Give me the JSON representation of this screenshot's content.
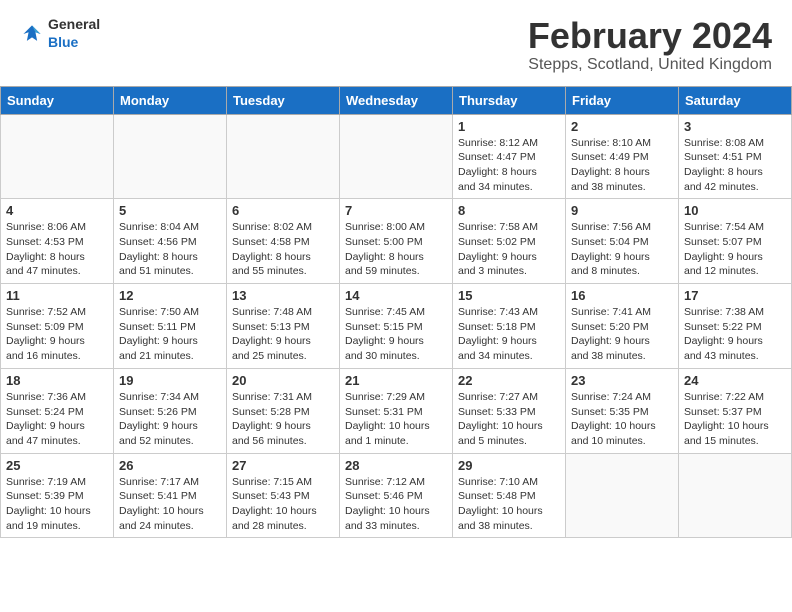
{
  "header": {
    "title": "February 2024",
    "location": "Stepps, Scotland, United Kingdom",
    "logo_general": "General",
    "logo_blue": "Blue"
  },
  "days_of_week": [
    "Sunday",
    "Monday",
    "Tuesday",
    "Wednesday",
    "Thursday",
    "Friday",
    "Saturday"
  ],
  "weeks": [
    [
      {
        "day": "",
        "info": ""
      },
      {
        "day": "",
        "info": ""
      },
      {
        "day": "",
        "info": ""
      },
      {
        "day": "",
        "info": ""
      },
      {
        "day": "1",
        "info": "Sunrise: 8:12 AM\nSunset: 4:47 PM\nDaylight: 8 hours\nand 34 minutes."
      },
      {
        "day": "2",
        "info": "Sunrise: 8:10 AM\nSunset: 4:49 PM\nDaylight: 8 hours\nand 38 minutes."
      },
      {
        "day": "3",
        "info": "Sunrise: 8:08 AM\nSunset: 4:51 PM\nDaylight: 8 hours\nand 42 minutes."
      }
    ],
    [
      {
        "day": "4",
        "info": "Sunrise: 8:06 AM\nSunset: 4:53 PM\nDaylight: 8 hours\nand 47 minutes."
      },
      {
        "day": "5",
        "info": "Sunrise: 8:04 AM\nSunset: 4:56 PM\nDaylight: 8 hours\nand 51 minutes."
      },
      {
        "day": "6",
        "info": "Sunrise: 8:02 AM\nSunset: 4:58 PM\nDaylight: 8 hours\nand 55 minutes."
      },
      {
        "day": "7",
        "info": "Sunrise: 8:00 AM\nSunset: 5:00 PM\nDaylight: 8 hours\nand 59 minutes."
      },
      {
        "day": "8",
        "info": "Sunrise: 7:58 AM\nSunset: 5:02 PM\nDaylight: 9 hours\nand 3 minutes."
      },
      {
        "day": "9",
        "info": "Sunrise: 7:56 AM\nSunset: 5:04 PM\nDaylight: 9 hours\nand 8 minutes."
      },
      {
        "day": "10",
        "info": "Sunrise: 7:54 AM\nSunset: 5:07 PM\nDaylight: 9 hours\nand 12 minutes."
      }
    ],
    [
      {
        "day": "11",
        "info": "Sunrise: 7:52 AM\nSunset: 5:09 PM\nDaylight: 9 hours\nand 16 minutes."
      },
      {
        "day": "12",
        "info": "Sunrise: 7:50 AM\nSunset: 5:11 PM\nDaylight: 9 hours\nand 21 minutes."
      },
      {
        "day": "13",
        "info": "Sunrise: 7:48 AM\nSunset: 5:13 PM\nDaylight: 9 hours\nand 25 minutes."
      },
      {
        "day": "14",
        "info": "Sunrise: 7:45 AM\nSunset: 5:15 PM\nDaylight: 9 hours\nand 30 minutes."
      },
      {
        "day": "15",
        "info": "Sunrise: 7:43 AM\nSunset: 5:18 PM\nDaylight: 9 hours\nand 34 minutes."
      },
      {
        "day": "16",
        "info": "Sunrise: 7:41 AM\nSunset: 5:20 PM\nDaylight: 9 hours\nand 38 minutes."
      },
      {
        "day": "17",
        "info": "Sunrise: 7:38 AM\nSunset: 5:22 PM\nDaylight: 9 hours\nand 43 minutes."
      }
    ],
    [
      {
        "day": "18",
        "info": "Sunrise: 7:36 AM\nSunset: 5:24 PM\nDaylight: 9 hours\nand 47 minutes."
      },
      {
        "day": "19",
        "info": "Sunrise: 7:34 AM\nSunset: 5:26 PM\nDaylight: 9 hours\nand 52 minutes."
      },
      {
        "day": "20",
        "info": "Sunrise: 7:31 AM\nSunset: 5:28 PM\nDaylight: 9 hours\nand 56 minutes."
      },
      {
        "day": "21",
        "info": "Sunrise: 7:29 AM\nSunset: 5:31 PM\nDaylight: 10 hours\nand 1 minute."
      },
      {
        "day": "22",
        "info": "Sunrise: 7:27 AM\nSunset: 5:33 PM\nDaylight: 10 hours\nand 5 minutes."
      },
      {
        "day": "23",
        "info": "Sunrise: 7:24 AM\nSunset: 5:35 PM\nDaylight: 10 hours\nand 10 minutes."
      },
      {
        "day": "24",
        "info": "Sunrise: 7:22 AM\nSunset: 5:37 PM\nDaylight: 10 hours\nand 15 minutes."
      }
    ],
    [
      {
        "day": "25",
        "info": "Sunrise: 7:19 AM\nSunset: 5:39 PM\nDaylight: 10 hours\nand 19 minutes."
      },
      {
        "day": "26",
        "info": "Sunrise: 7:17 AM\nSunset: 5:41 PM\nDaylight: 10 hours\nand 24 minutes."
      },
      {
        "day": "27",
        "info": "Sunrise: 7:15 AM\nSunset: 5:43 PM\nDaylight: 10 hours\nand 28 minutes."
      },
      {
        "day": "28",
        "info": "Sunrise: 7:12 AM\nSunset: 5:46 PM\nDaylight: 10 hours\nand 33 minutes."
      },
      {
        "day": "29",
        "info": "Sunrise: 7:10 AM\nSunset: 5:48 PM\nDaylight: 10 hours\nand 38 minutes."
      },
      {
        "day": "",
        "info": ""
      },
      {
        "day": "",
        "info": ""
      }
    ]
  ]
}
